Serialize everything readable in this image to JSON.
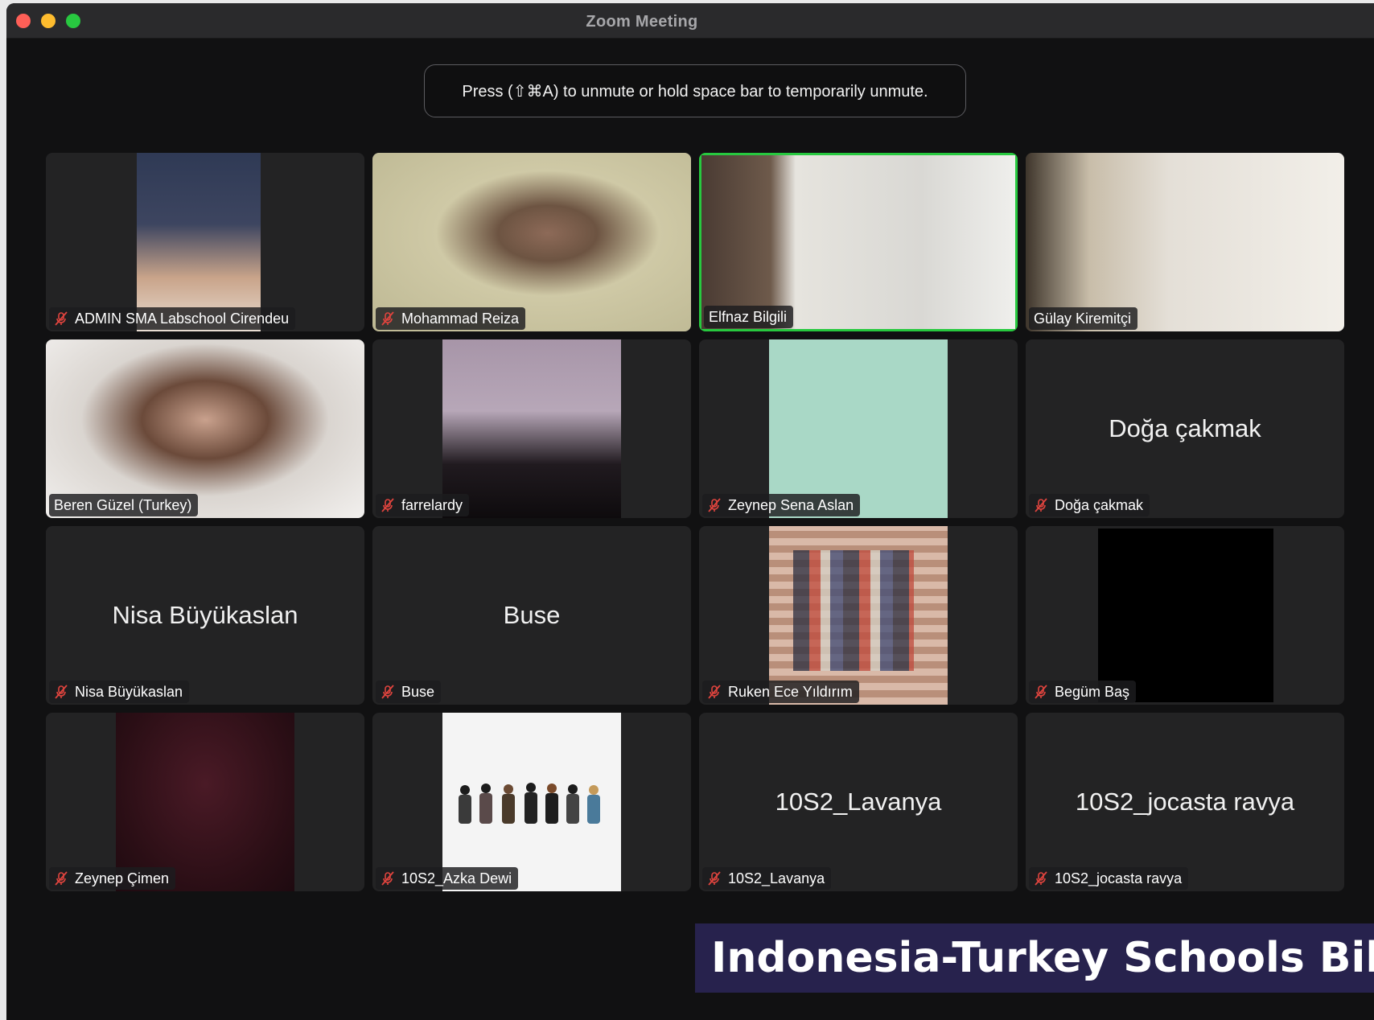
{
  "window": {
    "title": "Zoom Meeting"
  },
  "toast": {
    "text": "Press  (⇧⌘A) to unmute or hold space bar to temporarily unmute."
  },
  "participants": [
    {
      "name": "ADMIN SMA Labschool Cirendeu",
      "muted": true,
      "video": "on"
    },
    {
      "name": "Mohammad Reiza",
      "muted": true,
      "video": "on"
    },
    {
      "name": "Elfnaz Bilgili",
      "muted": false,
      "video": "on",
      "active_speaker": true
    },
    {
      "name": "Gülay Kiremitçi",
      "muted": false,
      "video": "on"
    },
    {
      "name": "Beren Güzel (Turkey)",
      "muted": false,
      "video": "on"
    },
    {
      "name": "farrelardy",
      "muted": true,
      "video": "on"
    },
    {
      "name": "Zeynep Sena Aslan",
      "muted": true,
      "video": "on"
    },
    {
      "name": "Doğa çakmak",
      "muted": true,
      "video": "off",
      "display_name": "Doğa çakmak"
    },
    {
      "name": "Nisa Büyükaslan",
      "muted": true,
      "video": "off",
      "display_name": "Nisa Büyükaslan"
    },
    {
      "name": "Buse",
      "muted": true,
      "video": "off",
      "display_name": "Buse"
    },
    {
      "name": "Ruken Ece Yıldırım",
      "muted": true,
      "video": "on"
    },
    {
      "name": "Begüm Baş",
      "muted": true,
      "video": "on"
    },
    {
      "name": "Zeynep Çimen",
      "muted": true,
      "video": "on"
    },
    {
      "name": "10S2_Azka Dewi",
      "muted": true,
      "video": "on"
    },
    {
      "name": "10S2_Lavanya",
      "muted": true,
      "video": "off",
      "display_name": "10S2_Lavanya"
    },
    {
      "name": "10S2_jocasta ravya",
      "muted": true,
      "video": "off",
      "display_name": "10S2_jocasta ravya"
    }
  ],
  "banner": {
    "text": "Indonesia-Turkey Schools Bilater"
  },
  "colors": {
    "active_speaker": "#27c93f",
    "mute_icon": "#e0443e",
    "banner_bg": "#27224d"
  }
}
